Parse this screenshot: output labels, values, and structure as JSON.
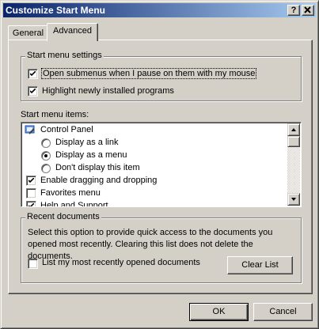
{
  "window": {
    "title": "Customize Start Menu",
    "help_button": "?",
    "close_button": "X"
  },
  "tabs": [
    {
      "label": "General",
      "selected": false
    },
    {
      "label": "Advanced",
      "selected": true
    }
  ],
  "start_menu_settings": {
    "group_label": "Start menu settings",
    "options": [
      {
        "label": "Open submenus when I pause on them with my mouse",
        "checked": true
      },
      {
        "label": "Highlight newly installed programs",
        "checked": true
      }
    ]
  },
  "start_menu_items": {
    "label": "Start menu items:",
    "control_panel": {
      "label": "Control Panel",
      "icon": "control-panel-icon"
    },
    "radio_options": [
      {
        "label": "Display as a link",
        "selected": false
      },
      {
        "label": "Display as a menu",
        "selected": true
      },
      {
        "label": "Don't display this item",
        "selected": false
      }
    ],
    "check_items": [
      {
        "label": "Enable dragging and dropping",
        "checked": true
      },
      {
        "label": "Favorites menu",
        "checked": false
      },
      {
        "label": "Help and Support",
        "checked": true
      }
    ]
  },
  "recent_documents": {
    "group_label": "Recent documents",
    "description": "Select this option to provide quick access to the documents you opened most recently.  Clearing this list does not delete the documents.",
    "list_option": {
      "label": "List my most recently opened documents",
      "checked": false
    },
    "clear_button": "Clear List"
  },
  "footer": {
    "ok_button": "OK",
    "cancel_button": "Cancel"
  },
  "colors": {
    "title_gradient_start": "#0a246a",
    "title_gradient_end": "#a6caf0",
    "face": "#d4d0c8"
  }
}
